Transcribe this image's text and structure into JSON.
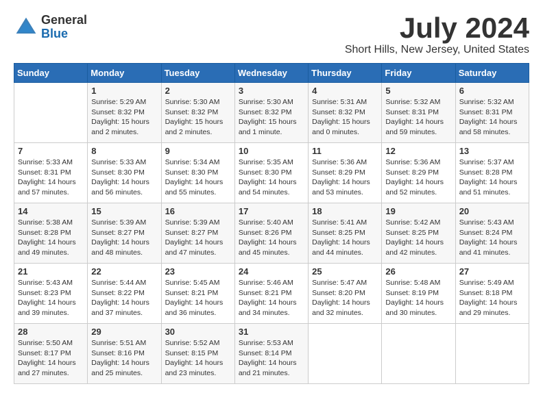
{
  "header": {
    "logo_general": "General",
    "logo_blue": "Blue",
    "title": "July 2024",
    "location": "Short Hills, New Jersey, United States"
  },
  "days_of_week": [
    "Sunday",
    "Monday",
    "Tuesday",
    "Wednesday",
    "Thursday",
    "Friday",
    "Saturday"
  ],
  "weeks": [
    [
      {
        "day": "",
        "info": ""
      },
      {
        "day": "1",
        "info": "Sunrise: 5:29 AM\nSunset: 8:32 PM\nDaylight: 15 hours\nand 2 minutes."
      },
      {
        "day": "2",
        "info": "Sunrise: 5:30 AM\nSunset: 8:32 PM\nDaylight: 15 hours\nand 2 minutes."
      },
      {
        "day": "3",
        "info": "Sunrise: 5:30 AM\nSunset: 8:32 PM\nDaylight: 15 hours\nand 1 minute."
      },
      {
        "day": "4",
        "info": "Sunrise: 5:31 AM\nSunset: 8:32 PM\nDaylight: 15 hours\nand 0 minutes."
      },
      {
        "day": "5",
        "info": "Sunrise: 5:32 AM\nSunset: 8:31 PM\nDaylight: 14 hours\nand 59 minutes."
      },
      {
        "day": "6",
        "info": "Sunrise: 5:32 AM\nSunset: 8:31 PM\nDaylight: 14 hours\nand 58 minutes."
      }
    ],
    [
      {
        "day": "7",
        "info": "Sunrise: 5:33 AM\nSunset: 8:31 PM\nDaylight: 14 hours\nand 57 minutes."
      },
      {
        "day": "8",
        "info": "Sunrise: 5:33 AM\nSunset: 8:30 PM\nDaylight: 14 hours\nand 56 minutes."
      },
      {
        "day": "9",
        "info": "Sunrise: 5:34 AM\nSunset: 8:30 PM\nDaylight: 14 hours\nand 55 minutes."
      },
      {
        "day": "10",
        "info": "Sunrise: 5:35 AM\nSunset: 8:30 PM\nDaylight: 14 hours\nand 54 minutes."
      },
      {
        "day": "11",
        "info": "Sunrise: 5:36 AM\nSunset: 8:29 PM\nDaylight: 14 hours\nand 53 minutes."
      },
      {
        "day": "12",
        "info": "Sunrise: 5:36 AM\nSunset: 8:29 PM\nDaylight: 14 hours\nand 52 minutes."
      },
      {
        "day": "13",
        "info": "Sunrise: 5:37 AM\nSunset: 8:28 PM\nDaylight: 14 hours\nand 51 minutes."
      }
    ],
    [
      {
        "day": "14",
        "info": "Sunrise: 5:38 AM\nSunset: 8:28 PM\nDaylight: 14 hours\nand 49 minutes."
      },
      {
        "day": "15",
        "info": "Sunrise: 5:39 AM\nSunset: 8:27 PM\nDaylight: 14 hours\nand 48 minutes."
      },
      {
        "day": "16",
        "info": "Sunrise: 5:39 AM\nSunset: 8:27 PM\nDaylight: 14 hours\nand 47 minutes."
      },
      {
        "day": "17",
        "info": "Sunrise: 5:40 AM\nSunset: 8:26 PM\nDaylight: 14 hours\nand 45 minutes."
      },
      {
        "day": "18",
        "info": "Sunrise: 5:41 AM\nSunset: 8:25 PM\nDaylight: 14 hours\nand 44 minutes."
      },
      {
        "day": "19",
        "info": "Sunrise: 5:42 AM\nSunset: 8:25 PM\nDaylight: 14 hours\nand 42 minutes."
      },
      {
        "day": "20",
        "info": "Sunrise: 5:43 AM\nSunset: 8:24 PM\nDaylight: 14 hours\nand 41 minutes."
      }
    ],
    [
      {
        "day": "21",
        "info": "Sunrise: 5:43 AM\nSunset: 8:23 PM\nDaylight: 14 hours\nand 39 minutes."
      },
      {
        "day": "22",
        "info": "Sunrise: 5:44 AM\nSunset: 8:22 PM\nDaylight: 14 hours\nand 37 minutes."
      },
      {
        "day": "23",
        "info": "Sunrise: 5:45 AM\nSunset: 8:21 PM\nDaylight: 14 hours\nand 36 minutes."
      },
      {
        "day": "24",
        "info": "Sunrise: 5:46 AM\nSunset: 8:21 PM\nDaylight: 14 hours\nand 34 minutes."
      },
      {
        "day": "25",
        "info": "Sunrise: 5:47 AM\nSunset: 8:20 PM\nDaylight: 14 hours\nand 32 minutes."
      },
      {
        "day": "26",
        "info": "Sunrise: 5:48 AM\nSunset: 8:19 PM\nDaylight: 14 hours\nand 30 minutes."
      },
      {
        "day": "27",
        "info": "Sunrise: 5:49 AM\nSunset: 8:18 PM\nDaylight: 14 hours\nand 29 minutes."
      }
    ],
    [
      {
        "day": "28",
        "info": "Sunrise: 5:50 AM\nSunset: 8:17 PM\nDaylight: 14 hours\nand 27 minutes."
      },
      {
        "day": "29",
        "info": "Sunrise: 5:51 AM\nSunset: 8:16 PM\nDaylight: 14 hours\nand 25 minutes."
      },
      {
        "day": "30",
        "info": "Sunrise: 5:52 AM\nSunset: 8:15 PM\nDaylight: 14 hours\nand 23 minutes."
      },
      {
        "day": "31",
        "info": "Sunrise: 5:53 AM\nSunset: 8:14 PM\nDaylight: 14 hours\nand 21 minutes."
      },
      {
        "day": "",
        "info": ""
      },
      {
        "day": "",
        "info": ""
      },
      {
        "day": "",
        "info": ""
      }
    ]
  ]
}
